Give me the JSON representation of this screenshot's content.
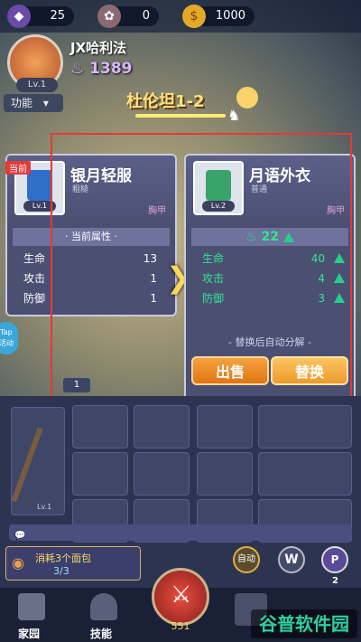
{
  "resources": {
    "gems": "25",
    "flowers": "0",
    "coins": "1000"
  },
  "player": {
    "name": "JX哈利法",
    "power": "1389",
    "level": "Lv.1"
  },
  "menu": {
    "function_label": "功能"
  },
  "stage": {
    "title": "杜伦坦1-2"
  },
  "current_item": {
    "badge": "当前",
    "name": "银月轻服",
    "grade": "粗糙",
    "type": "胸甲",
    "level": "Lv.1",
    "section_title": "当前属性",
    "stats": [
      {
        "label": "生命",
        "value": "13"
      },
      {
        "label": "攻击",
        "value": "1"
      },
      {
        "label": "防御",
        "value": "1"
      }
    ]
  },
  "new_item": {
    "name": "月语外衣",
    "grade": "普通",
    "type": "胸甲",
    "level": "Lv.2",
    "power_gain": "22",
    "stats": [
      {
        "label": "生命",
        "value": "40"
      },
      {
        "label": "攻击",
        "value": "4"
      },
      {
        "label": "防御",
        "value": "3"
      }
    ],
    "note": "替换后自动分解",
    "sell_label": "出售",
    "replace_label": "替换"
  },
  "progress": {
    "page": "1"
  },
  "side_tap": {
    "label": "Tap",
    "sub": "活动"
  },
  "quest": {
    "title": "消耗3个面包",
    "progress": "3/3"
  },
  "auto_label": "自动",
  "w_label": "W",
  "p_badge": "2",
  "weapon_level": "Lv.1",
  "nav": {
    "home": "家园",
    "skills": "技能",
    "fight_count": "551"
  },
  "watermark": "谷普软件园",
  "colors": {
    "accent_gold": "#ffe082",
    "stat_green": "#2ee88e",
    "sell_orange": "#f08a24",
    "replace_orange": "#f2a93b",
    "highlight_red": "#e53935"
  }
}
